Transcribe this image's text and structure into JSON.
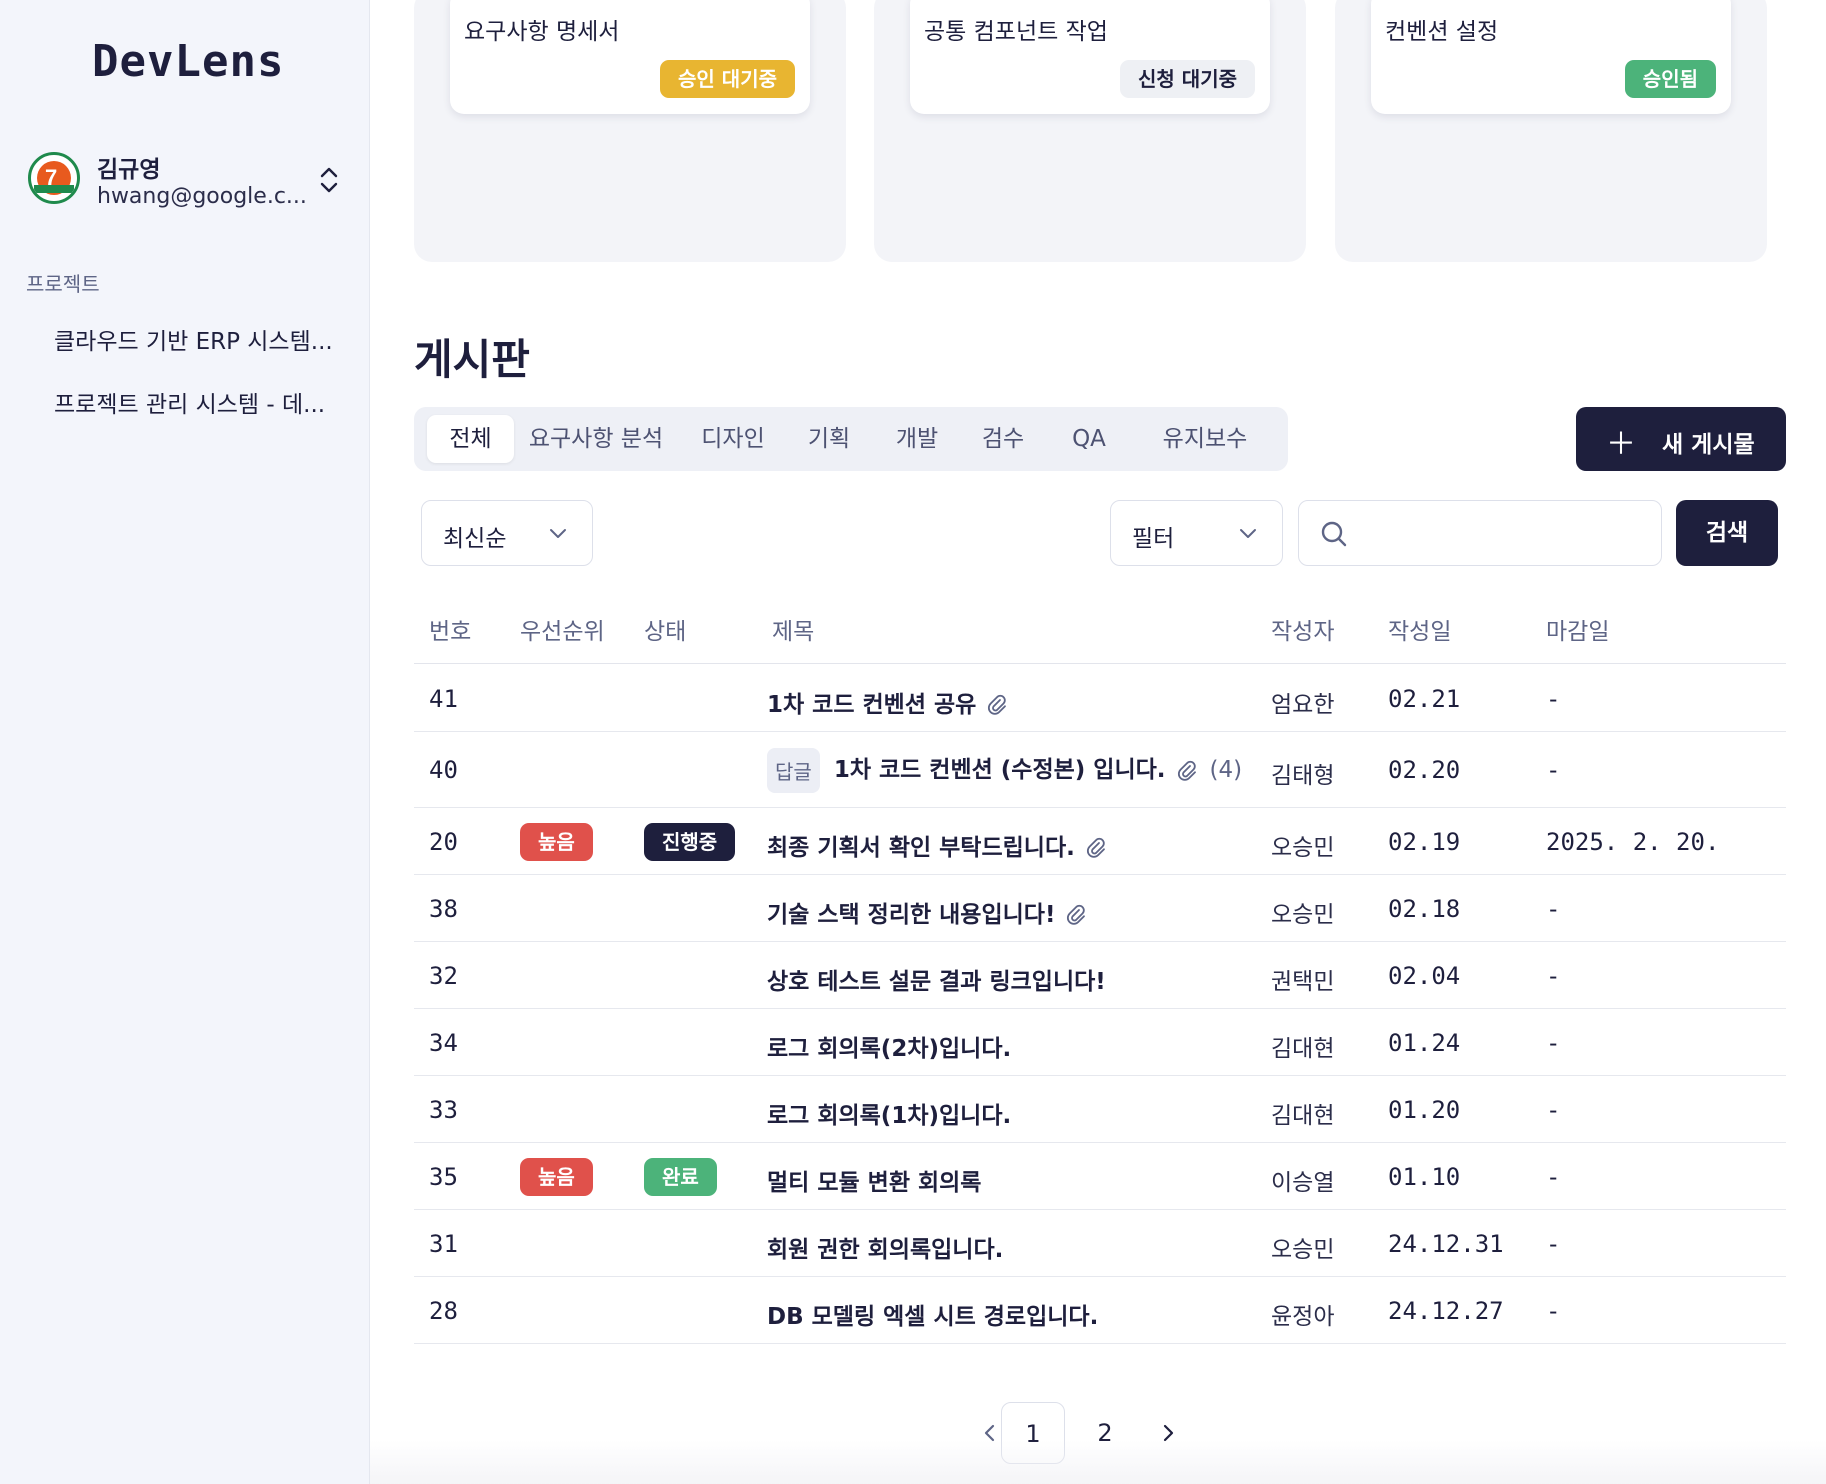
{
  "app": {
    "name": "DevLens"
  },
  "user": {
    "name": "김규영",
    "email": "hwang@google.c...",
    "avatar_icon": "seven-eleven-logo-icon"
  },
  "sidebar": {
    "section_label": "프로젝트",
    "projects": [
      {
        "label": "클라우드 기반 ERP 시스템..."
      },
      {
        "label": "프로젝트 관리 시스템 - 데..."
      }
    ]
  },
  "cards": [
    {
      "title": "요구사항 명세서",
      "status": "승인 대기중",
      "status_color": "#e8b531"
    },
    {
      "title": "공통 컴포넌트 작업",
      "status": "신청 대기중",
      "status_color": "#eef0f4"
    },
    {
      "title": "컨벤션 설정",
      "status": "승인됨",
      "status_color": "#4cb37a"
    }
  ],
  "board": {
    "title": "게시판",
    "tabs": [
      "전체",
      "요구사항 분석",
      "디자인",
      "기획",
      "개발",
      "검수",
      "QA",
      "유지보수"
    ],
    "active_tab": "전체",
    "new_post_label": "새 게시물",
    "sort_label": "최신순",
    "filter_label": "필터",
    "search_placeholder": "",
    "search_button": "검색"
  },
  "table": {
    "columns": [
      "번호",
      "우선순위",
      "상태",
      "제목",
      "작성자",
      "작성일",
      "마감일"
    ],
    "rows": [
      {
        "num": "41",
        "priority": "",
        "status": "",
        "title": "1차 코드 컨벤션 공유",
        "reply": "",
        "count": "",
        "attachment": true,
        "author": "엄요한",
        "date": "02.21",
        "due": "-"
      },
      {
        "num": "40",
        "priority": "",
        "status": "",
        "title": "1차 코드 컨벤션 (수정본) 입니다.",
        "reply": "답글",
        "count": "(4)",
        "attachment": true,
        "author": "김태형",
        "date": "02.20",
        "due": "-"
      },
      {
        "num": "20",
        "priority": "높음",
        "status": "진행중",
        "title": "최종 기획서 확인 부탁드립니다.",
        "reply": "",
        "count": "",
        "attachment": true,
        "author": "오승민",
        "date": "02.19",
        "due": "2025. 2. 20."
      },
      {
        "num": "38",
        "priority": "",
        "status": "",
        "title": "기술 스택 정리한 내용입니다!",
        "reply": "",
        "count": "",
        "attachment": true,
        "author": "오승민",
        "date": "02.18",
        "due": "-"
      },
      {
        "num": "32",
        "priority": "",
        "status": "",
        "title": "상호 테스트 설문 결과 링크입니다!",
        "reply": "",
        "count": "",
        "attachment": false,
        "author": "권택민",
        "date": "02.04",
        "due": "-"
      },
      {
        "num": "34",
        "priority": "",
        "status": "",
        "title": "로그 회의록(2차)입니다.",
        "reply": "",
        "count": "",
        "attachment": false,
        "author": "김대현",
        "date": "01.24",
        "due": "-"
      },
      {
        "num": "33",
        "priority": "",
        "status": "",
        "title": "로그 회의록(1차)입니다.",
        "reply": "",
        "count": "",
        "attachment": false,
        "author": "김대현",
        "date": "01.20",
        "due": "-"
      },
      {
        "num": "35",
        "priority": "높음",
        "status": "완료",
        "title": "멀티 모듈 변환 회의록",
        "reply": "",
        "count": "",
        "attachment": false,
        "author": "이승열",
        "date": "01.10",
        "due": "-"
      },
      {
        "num": "31",
        "priority": "",
        "status": "",
        "title": "회원 권한 회의록입니다.",
        "reply": "",
        "count": "",
        "attachment": false,
        "author": "오승민",
        "date": "24.12.31",
        "due": "-"
      },
      {
        "num": "28",
        "priority": "",
        "status": "",
        "title": "DB 모델링 엑셀 시트 경로입니다.",
        "reply": "",
        "count": "",
        "attachment": false,
        "author": "윤정아",
        "date": "24.12.27",
        "due": "-"
      }
    ]
  },
  "pagination": {
    "pages": [
      "1",
      "2"
    ],
    "current": "1"
  },
  "colors": {
    "primary": "#1e1f3d",
    "priority_high": "#e0514b",
    "status_in_progress": "#1e1f3d",
    "status_done": "#4cb37a"
  }
}
